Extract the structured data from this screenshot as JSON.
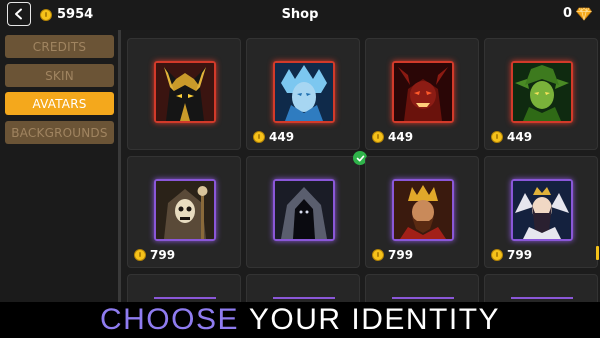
{
  "header": {
    "title": "Shop",
    "coins": "5954",
    "gems": "0",
    "back_icon": "chevron-left-icon",
    "coin_icon": "coin-icon",
    "gem_icon": "diamond-icon"
  },
  "sidebar": {
    "items": [
      {
        "label": "CREDITS",
        "active": false
      },
      {
        "label": "SKIN",
        "active": false
      },
      {
        "label": "AVATARS",
        "active": true
      },
      {
        "label": "BACKGROUNDS",
        "active": false
      }
    ]
  },
  "avatars": [
    {
      "id": "anubis",
      "price": "",
      "frame": "#d23a2a"
    },
    {
      "id": "ice-queen",
      "price": "449",
      "frame": "#d23a2a"
    },
    {
      "id": "demon",
      "price": "449",
      "frame": "#d23a2a"
    },
    {
      "id": "forest-elf",
      "price": "449",
      "frame": "#d23a2a"
    },
    {
      "id": "lich",
      "price": "799",
      "frame": "#8a57d8"
    },
    {
      "id": "hooded-shadow",
      "price": "",
      "frame": "#8a57d8",
      "owned": true
    },
    {
      "id": "king",
      "price": "799",
      "frame": "#8a57d8"
    },
    {
      "id": "queen",
      "price": "799",
      "frame": "#8a57d8"
    }
  ],
  "banner": {
    "word1": "CHOOSE",
    "word2": "YOUR IDENTITY"
  },
  "colors": {
    "accent": "#f4a81c",
    "inactive_tab": "#6b5436",
    "banner_purple": "#8f7cf0",
    "owned_check": "#2fb34a"
  }
}
